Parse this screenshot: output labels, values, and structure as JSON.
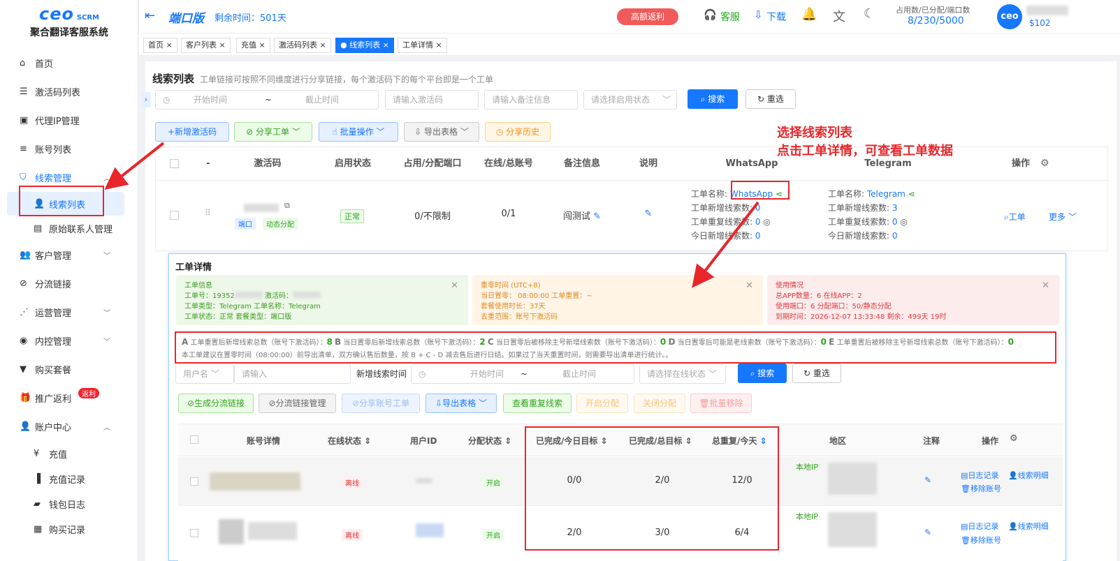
{
  "logo": {
    "brand": "ceo",
    "scrm": "SCRM",
    "subtitle": "聚合翻译客服系统"
  },
  "menu": [
    {
      "label": "首页",
      "icon": "home-icon"
    },
    {
      "label": "激活码列表",
      "icon": "list-icon"
    },
    {
      "label": "代理IP管理",
      "icon": "ip-icon"
    },
    {
      "label": "账号列表",
      "icon": "account-list-icon"
    },
    {
      "label": "线索管理",
      "icon": "shield-icon"
    },
    {
      "label": "线索列表",
      "icon": "user-icon"
    },
    {
      "label": "原始联系人管理",
      "icon": "contact-icon"
    },
    {
      "label": "客户管理",
      "icon": "customer-icon"
    },
    {
      "label": "分流链接",
      "icon": "link-icon"
    },
    {
      "label": "运营管理",
      "icon": "ops-icon"
    },
    {
      "label": "内控管理",
      "icon": "control-icon"
    },
    {
      "label": "购买套餐",
      "icon": "package-icon"
    },
    {
      "label": "推广返利",
      "icon": "gift-icon",
      "badge": "返利"
    },
    {
      "label": "账户中心",
      "icon": "account-center-icon"
    },
    {
      "label": "充值",
      "icon": "yen-icon"
    },
    {
      "label": "充值记录",
      "icon": "record-icon"
    },
    {
      "label": "钱包日志",
      "icon": "wallet-icon"
    },
    {
      "label": "购买记录",
      "icon": "purchase-icon"
    }
  ],
  "topbar": {
    "version": "端口版",
    "remaining": "剩余时间：501天",
    "promo": "高额返利",
    "service": "客服",
    "download": "下载",
    "usage_label": "占用数/已分配/端口数",
    "usage_value": "8/230/5000",
    "avatar": "ceo",
    "balance": "$102"
  },
  "tabs": [
    "首页 ×",
    "客户列表 ×",
    "充值 ×",
    "激活码列表 ×",
    "● 线索列表 ×",
    "工单详情 ×"
  ],
  "page": {
    "title": "线索列表",
    "desc": "工单链接可按照不同维度进行分享链接，每个激活码下的每个平台即是一个工单"
  },
  "filters": {
    "start": "开始时间",
    "tilde": "~",
    "end": "截止时间",
    "code": "请输入激活码",
    "remark": "请输入备注信息",
    "status": "请选择启用状态",
    "search": "搜索",
    "reset": "重选"
  },
  "actions": {
    "add": "+新增激活码",
    "share": "分享工单",
    "batch": "批量操作",
    "export": "导出表格",
    "history": "分享历史"
  },
  "annotation": {
    "line1": "选择线索列表",
    "line2": "点击工单详情，可查看工单数据"
  },
  "table": {
    "headers": [
      "-",
      "激活码",
      "启用状态",
      "占用/分配端口",
      "在线/总账号",
      "备注信息",
      "说明",
      "WhatsApp",
      "Telegram",
      "操作"
    ],
    "row": {
      "tag1": "端口",
      "tag2": "动态分配",
      "status": "正常",
      "ports": "0/不限制",
      "accounts": "0/1",
      "remark": "闯测试",
      "wa": {
        "name_label": "工单名称:",
        "name": "WhatsApp",
        "new_label": "工单新增线索数:",
        "new": "0",
        "dup_label": "工单重复线索数:",
        "dup": "0",
        "today_label": "今日新增线索数:",
        "today": "0"
      },
      "tg": {
        "name_label": "工单名称:",
        "name": "Telegram",
        "new_label": "工单新增线索数:",
        "new": "3",
        "dup_label": "工单重复线索数:",
        "dup": "0",
        "today_label": "今日新增线索数:",
        "today": "0"
      },
      "op1": "工单",
      "op2": "更多"
    }
  },
  "modal": {
    "title": "工单详情",
    "card1": {
      "title": "工单信息",
      "l1": "工单号：19352",
      "l1b": "激活码：",
      "l2": "工单类型：Telegram",
      "l2b": "工单名称：Telegram",
      "l3": "工单状态：正常",
      "l3b": "套餐类型：端口版"
    },
    "card2": {
      "title": "重零时间 (UTC+8)",
      "l1": "当日置零： 08:00:00",
      "l1b": "工单重置：~",
      "l2": "套餐使用时长：37天",
      "l3": "去重范围：账号下激活码"
    },
    "card3": {
      "title": "使用情况",
      "l1": "总APP数量：6",
      "l1b": "在线APP：2",
      "l2": "使用端口：6",
      "l2b": "分配端口：50/静态分配",
      "l3": "到期时间：2026-12-07 13:33:48",
      "l3b": "剩余：499天 19时"
    },
    "stats": {
      "a_letter": "A",
      "a": "工单重置后新增线索总数（账号下激活码）：",
      "a_val": "8",
      "b_letter": "B",
      "b": "当日置零后新增线索总数（账号下激活码）：",
      "b_val": "2",
      "c_letter": "C",
      "c": "当日置零后被移除主号新增线索数（账号下激活码）：",
      "c_val": "0",
      "d_letter": "D",
      "d": "当日置零后可能是老线索数（账号下激活码）：",
      "d_val": "0",
      "e_letter": "E",
      "e": "工单重置后被移除主号新增线索总数（账号下激活码）：",
      "e_val": "0",
      "note": "本工单建议在置零时间（08:00:00）前导出清单，双方确认售后数量，按 B + C - D 减去售后进行日结。如果过了当天重置时间，则需要导出清单进行统计。。"
    },
    "filters": {
      "user": "用户名",
      "input": "请输入",
      "time_label": "新增线索时间",
      "start": "开始时间",
      "tilde": "~",
      "end": "截止时间",
      "online": "请选择在线状态",
      "search": "搜索",
      "reset": "重选"
    },
    "actions": {
      "gen": "生成分流链接",
      "manage": "分流链接管理",
      "share": "分享账号工单",
      "export": "导出表格",
      "dup": "查看重复线索",
      "open": "开启分配",
      "close": "关闭分配",
      "remove": "批量移除"
    },
    "headers": [
      "账号详情",
      "在线状态",
      "用户ID",
      "分配状态",
      "已完成/今日目标",
      "已完成/总目标",
      "总重复/今天",
      "地区",
      "注释",
      "操作"
    ],
    "rows": [
      {
        "online": "离线",
        "assign": "开启",
        "today": "0/0",
        "total": "2/0",
        "dup": "12/0",
        "region": "本地IP",
        "op1": "日志记录",
        "op2": "线索明细",
        "op3": "移除账号"
      },
      {
        "online": "离线",
        "assign": "开启",
        "today": "2/0",
        "total": "3/0",
        "dup": "6/4",
        "region": "本地IP",
        "op1": "日志记录",
        "op2": "线索明细",
        "op3": "移除账号"
      }
    ]
  }
}
